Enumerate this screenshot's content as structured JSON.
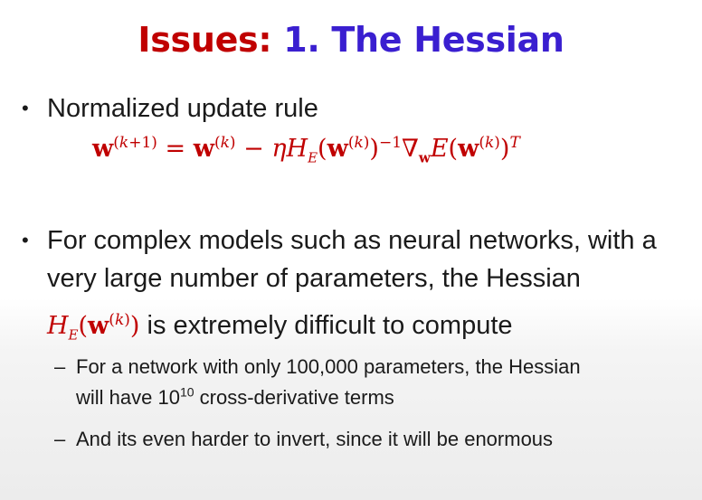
{
  "title": {
    "part1": "Issues:",
    "part2": "1. The Hessian"
  },
  "bullets": [
    {
      "text": "Normalized update rule"
    },
    {
      "lines": [
        "For complex models such as neural networks, with a",
        "very large number of parameters, the Hessian",
        "is extremely difficult to compute"
      ]
    }
  ],
  "formula": {
    "text": "w(k+1) = w(k) − ηHE(w(k))−1 ∇wE(w(k))T"
  },
  "inline_math": {
    "text": "HE(w(k))"
  },
  "subbullets": [
    {
      "line1": "For a network with only 100,000 parameters, the Hessian",
      "line2_pre": "will have 10",
      "line2_sup": "10",
      "line2_post": " cross-derivative terms"
    },
    {
      "text": "And its even harder to invert, since it will be enormous"
    }
  ],
  "colors": {
    "accent_red": "#c00000",
    "accent_blue": "#3a1fd0"
  }
}
